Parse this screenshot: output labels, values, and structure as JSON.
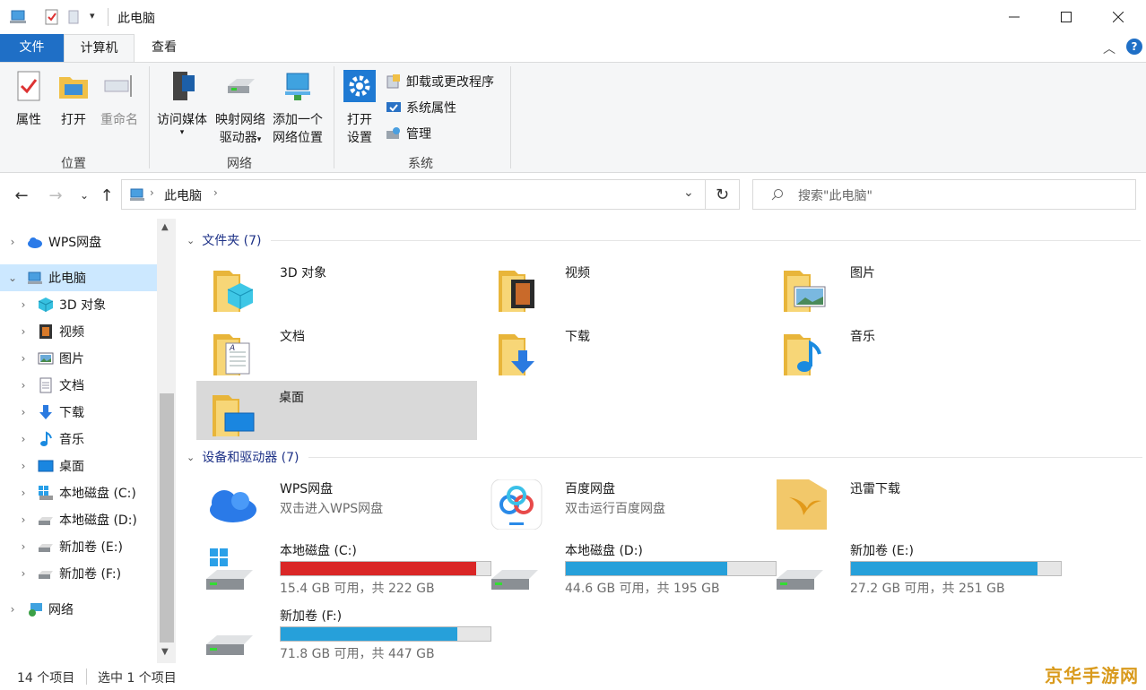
{
  "window": {
    "title": "此电脑"
  },
  "tabs": {
    "file": "文件",
    "computer": "计算机",
    "view": "查看"
  },
  "ribbon": {
    "properties": "属性",
    "open": "打开",
    "rename": "重命名",
    "group_location": "位置",
    "access_media": "访问媒体",
    "map_drive_1": "映射网络",
    "map_drive_2": "驱动器",
    "add_net_1": "添加一个",
    "add_net_2": "网络位置",
    "group_network": "网络",
    "open_settings_1": "打开",
    "open_settings_2": "设置",
    "uninstall": "卸载或更改程序",
    "system_props": "系统属性",
    "manage": "管理",
    "group_system": "系统"
  },
  "address": {
    "crumb": "此电脑",
    "search_placeholder": "搜索\"此电脑\""
  },
  "nav": {
    "items": [
      "WPS网盘",
      "此电脑",
      "3D 对象",
      "视频",
      "图片",
      "文档",
      "下载",
      "音乐",
      "桌面",
      "本地磁盘 (C:)",
      "本地磁盘 (D:)",
      "新加卷 (E:)",
      "新加卷 (F:)",
      "网络"
    ]
  },
  "folders": {
    "header": "文件夹 (7)",
    "items": [
      "3D 对象",
      "视频",
      "图片",
      "文档",
      "下载",
      "音乐",
      "桌面"
    ]
  },
  "drives": {
    "header": "设备和驱动器 (7)",
    "apps": [
      {
        "name": "WPS网盘",
        "sub": "双击进入WPS网盘"
      },
      {
        "name": "百度网盘",
        "sub": "双击运行百度网盘"
      },
      {
        "name": "迅雷下载",
        "sub": ""
      }
    ],
    "disks": [
      {
        "name": "本地磁盘 (C:)",
        "free": "15.4 GB 可用，共 222 GB",
        "used_fraction": 0.93
      },
      {
        "name": "本地磁盘 (D:)",
        "free": "44.6 GB 可用，共 195 GB",
        "used_fraction": 0.77
      },
      {
        "name": "新加卷 (E:)",
        "free": "27.2 GB 可用，共 251 GB",
        "used_fraction": 0.89
      },
      {
        "name": "新加卷 (F:)",
        "free": "71.8 GB 可用，共 447 GB",
        "used_fraction": 0.84
      }
    ]
  },
  "status": {
    "count": "14 个项目",
    "selected": "选中 1 个项目"
  },
  "watermark": "京华手游网"
}
